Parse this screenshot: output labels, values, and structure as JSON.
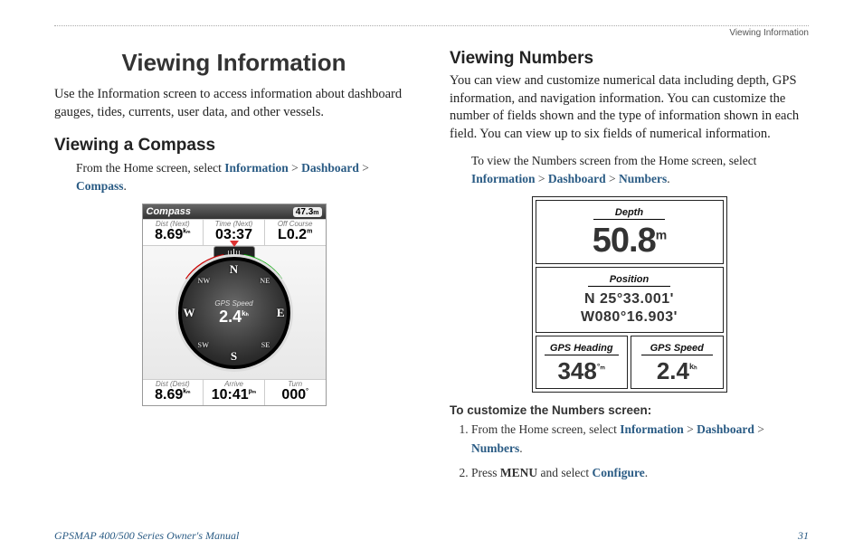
{
  "header": {
    "running_head": "Viewing Information"
  },
  "left": {
    "title": "Viewing Information",
    "intro": "Use the Information screen to access information about dashboard gauges, tides, currents, user data, and other vessels.",
    "section1": {
      "heading": "Viewing a Compass",
      "lead": "From the Home screen, select ",
      "path": {
        "a": "Information",
        "b": "Dashboard",
        "c": "Compass"
      }
    }
  },
  "right": {
    "section2": {
      "heading": "Viewing Numbers",
      "body": "You can view and customize numerical data including depth, GPS information, and navigation information. You can customize the number of fields shown and the type of information shown in each field. You can view up to six fields of numerical information.",
      "lead": "To view the Numbers screen from the Home screen, select ",
      "path": {
        "a": "Information",
        "b": "Dashboard",
        "c": "Numbers"
      }
    },
    "customize": {
      "heading": "To customize the Numbers screen:",
      "steps": [
        {
          "pre": "From the Home screen, select ",
          "a": "Information",
          "b": "Dashboard",
          "c": "Numbers"
        },
        {
          "pre": "Press ",
          "menu": "MENU",
          "mid": " and select ",
          "cfg": "Configure"
        }
      ]
    }
  },
  "footer": {
    "manual": "GPSMAP 400/500 Series Owner's Manual",
    "page": "31"
  },
  "compass_screen": {
    "title": "Compass",
    "heading_value": "47.3",
    "heading_unit": "m",
    "top_row": [
      {
        "label": "Dist (Next)",
        "value": "8.69",
        "unit": "kₘ"
      },
      {
        "label": "Time (Next)",
        "value": "03:37",
        "unit": ""
      },
      {
        "label": "Off Course",
        "value": "L0.2",
        "unit": "m"
      }
    ],
    "center": {
      "label": "GPS Speed",
      "value": "2.4",
      "unit": "kₕ"
    },
    "cardinals": {
      "N": "N",
      "S": "S",
      "E": "E",
      "W": "W",
      "NE": "NE",
      "NW": "NW",
      "SE": "SE",
      "SW": "SW"
    },
    "bottom_row": [
      {
        "label": "Dist (Dest)",
        "value": "8.69",
        "unit": "kₘ"
      },
      {
        "label": "Arrive",
        "value": "10:41",
        "unit": "pₘ"
      },
      {
        "label": "Turn",
        "value": "000",
        "unit": "°"
      }
    ]
  },
  "numbers_screen": {
    "depth": {
      "label": "Depth",
      "value": "50.8",
      "unit": "m"
    },
    "position": {
      "label": "Position",
      "lat": "N  25°33.001'",
      "lon": "W080°16.903'"
    },
    "heading": {
      "label": "GPS Heading",
      "value": "348",
      "unit": "°ₘ"
    },
    "speed": {
      "label": "GPS Speed",
      "value": "2.4",
      "unit": "kₕ"
    }
  }
}
